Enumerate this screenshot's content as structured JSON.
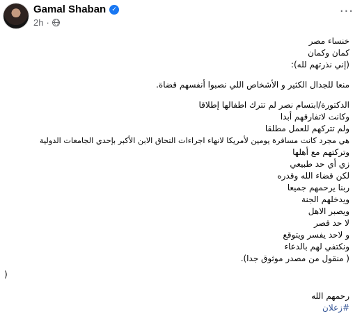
{
  "post": {
    "author": "Gamal Shaban",
    "time": "2h",
    "more_label": "···",
    "icons": {
      "verified": "verified-badge-icon",
      "privacy": "globe-icon",
      "more": "more-options-icon"
    },
    "accent_color": "#1877f2",
    "hashtag_color": "#385898"
  },
  "content": {
    "para1": [
      "خنساء مصر",
      "كمان وكمان",
      "(إني نذرتهم لله):"
    ],
    "para2": [
      "منعا للجدال الكثير و الأشخاص اللي نصبوا أنفسهم قضاة."
    ],
    "para3": [
      "الدكتورة/ابتسام نصر لم تترك اطفالها إطلاقا",
      "وكانت لاتفارقهم أبدا",
      "ولم تتركهم للعمل مطلقا",
      "هي مجرد كانت مسافرة يومين لأمريكا لانهاء اجراءات التحاق الابن الأكبر بإحدي الجامعات الدولية",
      "وتركتهم مع أهلها",
      "زي أي حد طبيعي",
      "لكن قضاء الله وقدره",
      "ربنا يرحمهم جميعا",
      "ويدخلهم الجنة",
      "ويصبر الاهل",
      "لا حد قصر",
      "و لاحد يفسر ويتوقع",
      "ونكتفي لهم بالدعاء",
      "( منقول من مصدر موثوق جدا)."
    ],
    "stray": ")",
    "closing": "رحمهم  الله",
    "hashtag": "#زعلان"
  }
}
